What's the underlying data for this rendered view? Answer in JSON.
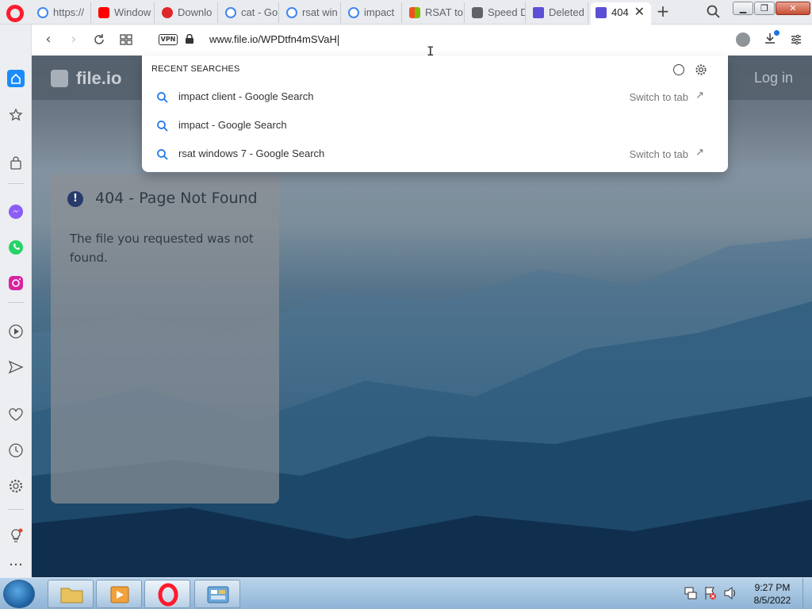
{
  "browser": {
    "tabs": [
      {
        "label": "https://",
        "favicon": "google-icon"
      },
      {
        "label": "Window",
        "favicon": "youtube-icon"
      },
      {
        "label": "Downlo",
        "favicon": "mega-icon"
      },
      {
        "label": "cat - Go",
        "favicon": "google-icon"
      },
      {
        "label": "rsat win",
        "favicon": "google-icon"
      },
      {
        "label": "impact",
        "favicon": "google-icon"
      },
      {
        "label": "RSAT to",
        "favicon": "microsoft-icon"
      },
      {
        "label": "Speed D",
        "favicon": "speed-dial-icon"
      },
      {
        "label": "Deleted",
        "favicon": "fileio-icon"
      },
      {
        "label": "404",
        "favicon": "fileio-icon",
        "active": true
      }
    ],
    "new_tab_label": "+",
    "tab_close_label": "✕"
  },
  "addressbar": {
    "vpn_label": "VPN",
    "url": "www.file.io/WPDtfn4mSVaH"
  },
  "dropdown": {
    "heading": "RECENT SEARCHES",
    "suggestions": [
      {
        "text": "impact client - Google Search",
        "switch_label": "Switch to tab"
      },
      {
        "text": "impact - Google Search",
        "switch_label": ""
      },
      {
        "text": "rsat windows 7 - Google Search",
        "switch_label": "Switch to tab"
      }
    ]
  },
  "page": {
    "site_name": "file.io",
    "login_label": "Log in",
    "error_title": "404 - Page Not Found",
    "error_message": "The file you requested was not found.",
    "error_icon_glyph": "!"
  },
  "taskbar": {
    "time": "9:27 PM",
    "date": "8/5/2022"
  },
  "colors": {
    "opera_red": "#ff1b2d",
    "sidebar_accent": "#1a8cff",
    "search_icon_blue": "#1a73e8"
  }
}
